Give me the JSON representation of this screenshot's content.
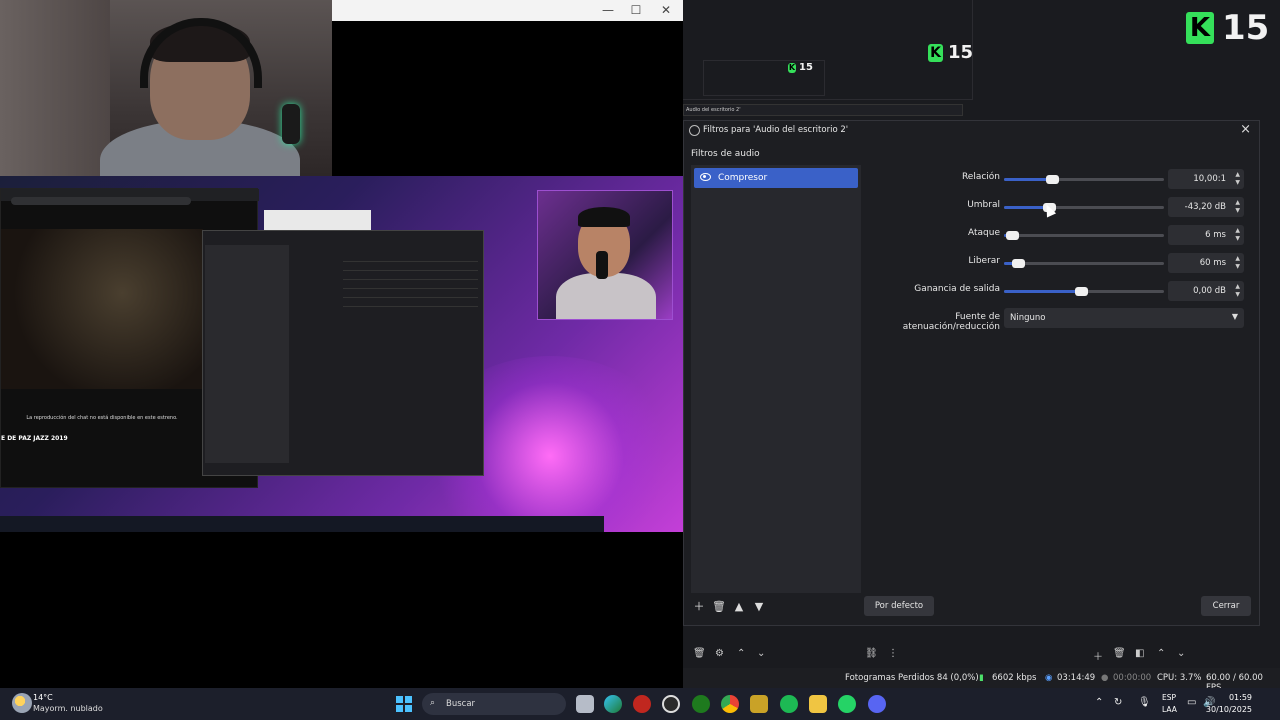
{
  "overlay": {
    "badge_k": "K",
    "badge_number": "15",
    "nested_number": "15"
  },
  "nested_dialog_title": "Audio del escritorio 2'",
  "dialog": {
    "title": "Filtros para 'Audio del escritorio 2'",
    "close": "×",
    "filters_label": "Filtros de audio",
    "filter_item": "Compresor",
    "properties": [
      {
        "label": "Relación",
        "value": "10,00:1",
        "level": 0.3
      },
      {
        "label": "Umbral",
        "value": "-43,20 dB",
        "level": 0.28
      },
      {
        "label": "Ataque",
        "value": "6 ms",
        "level": 0.05
      },
      {
        "label": "Liberar",
        "value": "60 ms",
        "level": 0.09
      },
      {
        "label": "Ganancia de salida",
        "value": "0,00 dB",
        "level": 0.48
      }
    ],
    "source_label": "Fuente de atenuación/reducción",
    "source_value": "Ninguno",
    "defaults_button": "Por defecto",
    "close_button": "Cerrar"
  },
  "status": {
    "dropped": "Fotogramas Perdidos 84 (0,0%)",
    "kbps": "6602 kbps",
    "time_live": "03:14:49",
    "time_rec": "00:00:00",
    "cpu": "CPU: 3.7%",
    "fps": "60.00 / 60.00 FPS"
  },
  "taskbar": {
    "weather_temp": "14°C",
    "weather_desc": "Mayorm. nublado",
    "search": "Buscar",
    "lang1": "ESP",
    "lang2": "LAA",
    "time": "01:59",
    "date": "30/10/2025"
  },
  "inner": {
    "chat_notice": "La reproducción del chat no está disponible en este estreno.",
    "yt_title": "E DE PAZ JAZZ 2019"
  }
}
